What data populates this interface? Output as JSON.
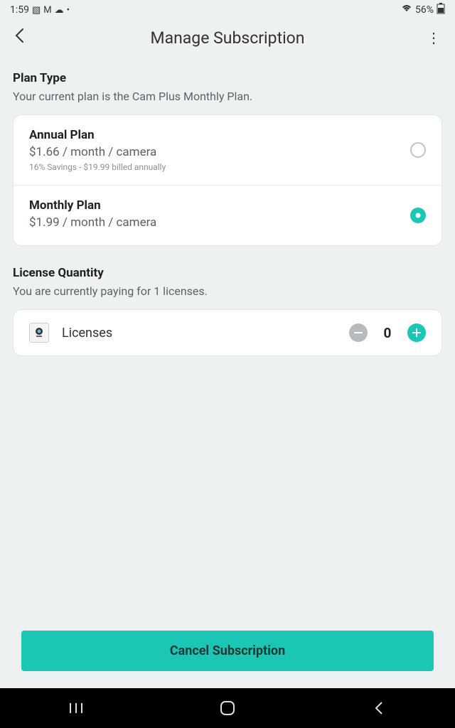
{
  "status_bar": {
    "time": "1:59",
    "battery_pct": "56%"
  },
  "header": {
    "title": "Manage Subscription"
  },
  "plan_type": {
    "title": "Plan Type",
    "desc": "Your current plan is the Cam Plus Monthly Plan.",
    "plans": [
      {
        "name": "Annual Plan",
        "price": "$1.66 / month / camera",
        "note": "16% Savings - $19.99 billed annually",
        "selected": false
      },
      {
        "name": "Monthly Plan",
        "price": "$1.99 / month / camera",
        "note": "",
        "selected": true
      }
    ]
  },
  "license": {
    "title": "License Quantity",
    "desc": "You are currently paying for 1 licenses.",
    "label": "Licenses",
    "value": "0"
  },
  "cancel_label": "Cancel Subscription"
}
